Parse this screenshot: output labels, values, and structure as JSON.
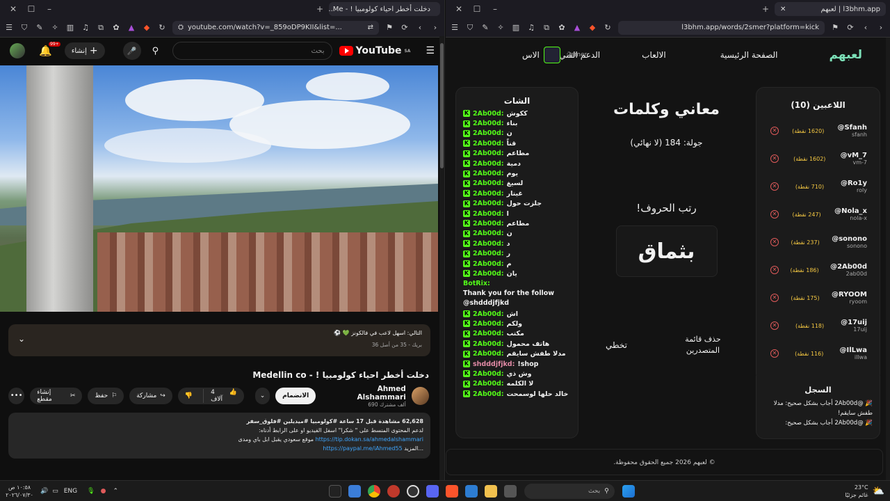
{
  "left_browser": {
    "tab_title": "دخلت أخطر احياء كولومبيا ! - Me...",
    "url": "youtube.com/watch?v=_859oDP9KII&list=...",
    "new_tab": "+",
    "window": {
      "minimize": "–",
      "maximize": "☐",
      "close": "✕"
    }
  },
  "youtube": {
    "logo": "YouTube",
    "logo_region": "SA",
    "search_placeholder": "بحث",
    "create_label": "إنشاء",
    "notif_badge": "99+",
    "next_card": {
      "title": "التالي: اسهل لاعب في فالكونز 💚 ⚽",
      "subtitle": "بريك - 35 من أصل 36"
    },
    "video_title": "دخلت أخطر احياء كولومبيا ! - Medellin co",
    "channel": "Ahmed Alshammari",
    "subscribers": "690 ألف مشترك",
    "join_label": "الانضمام",
    "likes": "4 آلاف",
    "share_label": "مشاركة",
    "save_label": "حفظ",
    "clip_label": "إنشاء مقطع",
    "description": {
      "stats": "62,628 مشاهدة قبل 17 ساعة #كولومبيا #ميديلين #فلوق_سفر",
      "line1": "لدعم المحتوى المنسط على \" شكرا\" اسفل الفيديو او على الرابط أدناه:",
      "line2": "موقع سعودي يقبل ابل باي ومدى",
      "link1": "https://tip.dokan.sa/ahmedalshammari",
      "link2": "https://paypal.me/iAhmed55",
      "more": "...المزيد"
    }
  },
  "right_browser": {
    "tab_title": "لعبهم | l3bhm.app",
    "url": "l3bhm.app/words/2smer?platform=kick",
    "new_tab": "+",
    "window": {
      "minimize": "–",
      "maximize": "☐",
      "close": "✕"
    }
  },
  "app": {
    "logo": "لعبهم",
    "nav": [
      "الصفحة الرئيسية",
      "الالعاب",
      "الدعم الفني",
      "الاس"
    ],
    "username": "2smer",
    "players_title": "اللاعبين (10)",
    "players": [
      {
        "name": "@Sfanh",
        "handle": "sfanh",
        "points": "(1620 نقطة)"
      },
      {
        "name": "@vM_7",
        "handle": "vm-7",
        "points": "(1602 نقطة)"
      },
      {
        "name": "@Ro1y",
        "handle": "roly",
        "points": "(710 نقطة)"
      },
      {
        "name": "@Nola_x",
        "handle": "nola-x",
        "points": "(247 نقطة)"
      },
      {
        "name": "@sonono",
        "handle": "sonono",
        "points": "(237 نقطة)"
      },
      {
        "name": "@2Ab00d",
        "handle": "2ab00d",
        "points": "(186 نقطة)"
      },
      {
        "name": "@RYOOM",
        "handle": "ryoom",
        "points": "(175 نقطة)"
      },
      {
        "name": "@17uij",
        "handle": "17uij",
        "points": "(118 نقطة)"
      },
      {
        "name": "@IlLwa",
        "handle": "illwa",
        "points": "(116 نقطة)"
      }
    ],
    "log_title": "السجل",
    "log": [
      "🎉 @2Ab00d أجاب بشكل صحيح: مدلا طفش سايقم!",
      "🎉 @2Ab00d أجاب بشكل صحيح:"
    ],
    "game_title": "معاني وكلمات",
    "round": "جولة: 184 (لا نهائي)",
    "instruction": "رتب الحروف!",
    "scrambled": "بثماق",
    "clear_board": "حذف قائمة المتصدرين",
    "skip": "تخطي",
    "chat_title": "الشات",
    "chat": [
      {
        "user": "2Ab00d:",
        "msg": "ككوش"
      },
      {
        "user": "2Ab00d:",
        "msg": "بناء"
      },
      {
        "user": "2Ab00d:",
        "msg": "ن"
      },
      {
        "user": "2Ab00d:",
        "msg": "قناً"
      },
      {
        "user": "2Ab00d:",
        "msg": "مطاعم"
      },
      {
        "user": "2Ab00d:",
        "msg": "دمية"
      },
      {
        "user": "2Ab00d:",
        "msg": "يوم"
      },
      {
        "user": "2Ab00d:",
        "msg": "لسيغ"
      },
      {
        "user": "2Ab00d:",
        "msg": "غيتار"
      },
      {
        "user": "2Ab00d:",
        "msg": "جلزت حول"
      },
      {
        "user": "2Ab00d:",
        "msg": "ا"
      },
      {
        "user": "2Ab00d:",
        "msg": "مطاعم"
      },
      {
        "user": "2Ab00d:",
        "msg": "ن"
      },
      {
        "user": "2Ab00d:",
        "msg": "د"
      },
      {
        "user": "2Ab00d:",
        "msg": "ر"
      },
      {
        "user": "2Ab00d:",
        "msg": "م"
      },
      {
        "user": "2Ab00d:",
        "msg": "يان"
      }
    ],
    "bot_user": "BotRix:",
    "bot_msg": "Thank you for the follow @shdddjfjkd",
    "chat2": [
      {
        "user": "2Ab00d:",
        "msg": "اش"
      },
      {
        "user": "2Ab00d:",
        "msg": "ولكم"
      },
      {
        "user": "2Ab00d:",
        "msg": "مكتب"
      },
      {
        "user": "2Ab00d:",
        "msg": "هاتف محمول"
      },
      {
        "user": "2Ab00d:",
        "msg": "مدلا طفش سايقم"
      },
      {
        "user": "shdddjfjkd:",
        "msg": "!shop"
      },
      {
        "user": "2Ab00d:",
        "msg": "وش ذي"
      },
      {
        "user": "2Ab00d:",
        "msg": "لا الكلمه"
      },
      {
        "user": "2Ab00d:",
        "msg": "خالد حلها لوسمحت"
      }
    ],
    "footer": "© لعبهم 2026 جميع الحقوق محفوظة."
  },
  "taskbar": {
    "time": "١٠:٥٨ ص",
    "date": "٢٠٢٦/٠٧/٣٠",
    "lang": "ENG",
    "search_placeholder": "بحث",
    "weather_temp": "23°C",
    "weather_desc": "غائم جزئيًا"
  },
  "colors": {
    "kick_green": "#53fc18",
    "yt_red": "#ff0000",
    "points": "#f5c842",
    "link": "#3ea6ff"
  }
}
